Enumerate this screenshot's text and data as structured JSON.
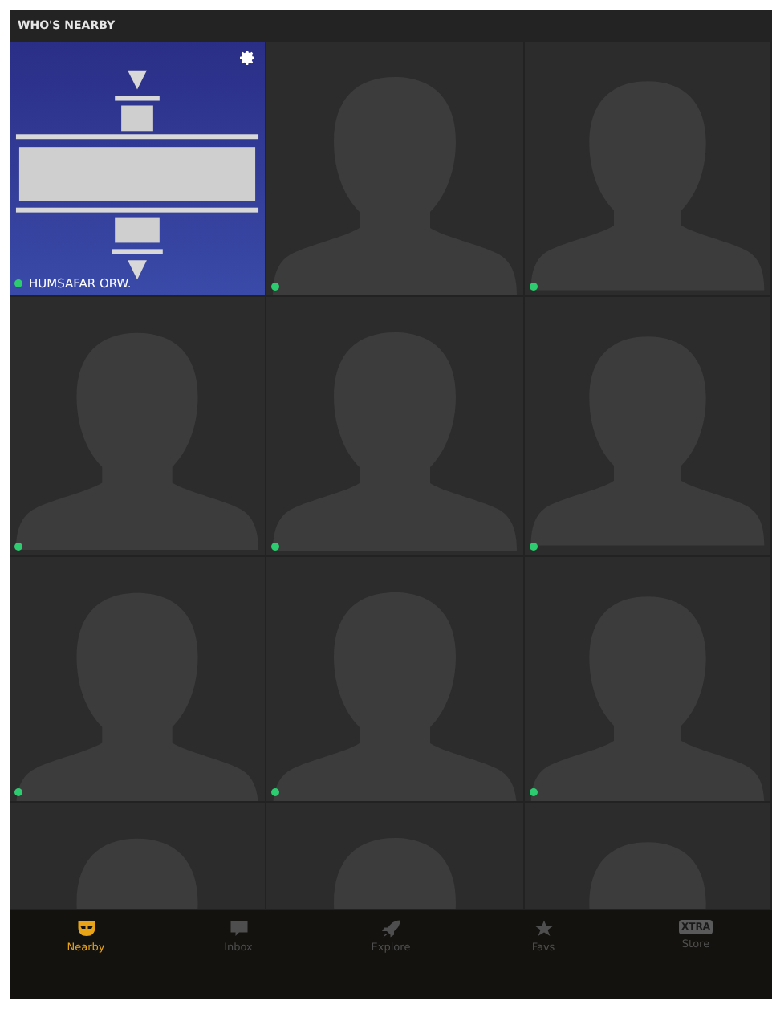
{
  "header": {
    "title": "WHO'S NEARBY"
  },
  "tiles": [
    {
      "name": "HUMSAFAR ORW.",
      "online": true
    },
    {
      "kind": "placeholder",
      "online": true
    },
    {
      "kind": "placeholder",
      "online": true
    },
    {
      "kind": "placeholder",
      "online": true
    },
    {
      "kind": "placeholder",
      "online": true
    },
    {
      "kind": "placeholder",
      "online": true
    },
    {
      "kind": "placeholder",
      "online": true
    },
    {
      "kind": "placeholder",
      "online": true
    },
    {
      "kind": "placeholder",
      "online": true
    },
    {
      "kind": "placeholder",
      "online": false
    },
    {
      "kind": "placeholder",
      "online": false
    },
    {
      "kind": "placeholder",
      "online": false
    }
  ],
  "tab_bar": [
    {
      "label": "Nearby",
      "selected": true
    },
    {
      "label": "Inbox",
      "selected": false
    },
    {
      "label": "Explore",
      "selected": false
    },
    {
      "label": "Favs",
      "selected": false
    },
    {
      "label": "Store",
      "badge": "XTRA",
      "selected": false
    }
  ]
}
